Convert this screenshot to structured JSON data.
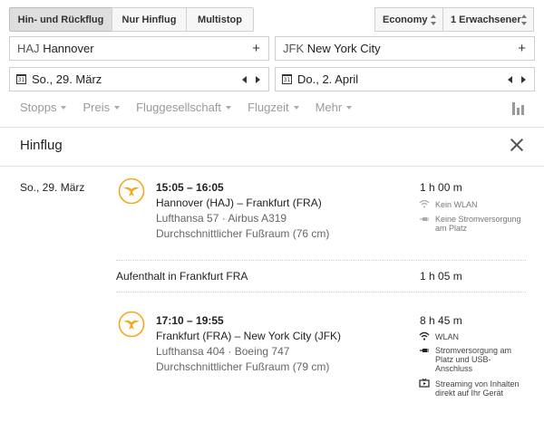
{
  "trip_types": [
    "Hin- und Rückflug",
    "Nur Hinflug",
    "Multistop"
  ],
  "cabin": "Economy",
  "passengers": "1 Erwachsener",
  "origin": {
    "code": "HAJ",
    "city": "Hannover"
  },
  "destination": {
    "code": "JFK",
    "city": "New York City"
  },
  "depart_date": "So., 29. März",
  "return_date": "Do., 2. April",
  "calendar_icon_text": "31",
  "filters": [
    "Stopps",
    "Preis",
    "Fluggesellschaft",
    "Flugzeit",
    "Mehr"
  ],
  "section_title": "Hinflug",
  "flight_date": "So., 29. März",
  "legs": [
    {
      "times": "15:05 – 16:05",
      "route": "Hannover (HAJ) – Frankfurt (FRA)",
      "flight": "Lufthansa 57 · Airbus A319",
      "legroom": "Durchschnittlicher Fußraum (76 cm)",
      "duration": "1 h 00 m",
      "amenities": [
        "Kein WLAN",
        "Keine Stromversorgung am Platz"
      ]
    },
    {
      "times": "17:10 – 19:55",
      "route": "Frankfurt (FRA) – New York City (JFK)",
      "flight": "Lufthansa 404 · Boeing 747",
      "legroom": "Durchschnittlicher Fußraum (79 cm)",
      "duration": "8 h 45 m",
      "amenities": [
        "WLAN",
        "Stromversorgung am Platz und USB-Anschluss",
        "Streaming von Inhalten direkt auf Ihr Gerät"
      ]
    }
  ],
  "layover": {
    "text": "Aufenthalt in Frankfurt FRA",
    "duration": "1 h 05 m"
  },
  "colors": {
    "accent": "#f3a81c",
    "muted": "#9a9a9a"
  }
}
